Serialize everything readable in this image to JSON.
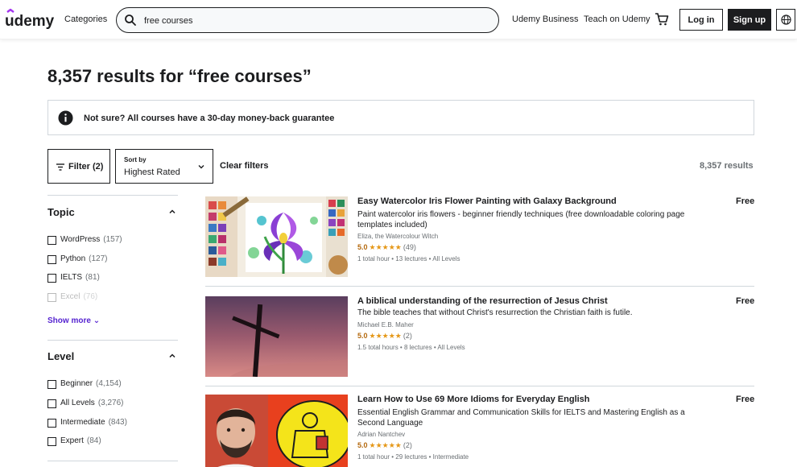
{
  "header": {
    "logo_text": "udemy",
    "categories_label": "Categories",
    "search_value": "free courses",
    "udemy_business_label": "Udemy Business",
    "teach_label": "Teach on Udemy",
    "login_label": "Log in",
    "signup_label": "Sign up"
  },
  "page_title": "8,357 results for “free courses”",
  "banner_text": "Not sure? All courses have a 30-day money-back guarantee",
  "toolbar": {
    "filter_label": "Filter (2)",
    "sort_label": "Sort by",
    "sort_value": "Highest Rated",
    "clear_filters": "Clear filters",
    "results_count": "8,357 results"
  },
  "sidebar": {
    "topic": {
      "title": "Topic",
      "items": [
        {
          "label": "WordPress",
          "count": "(157)"
        },
        {
          "label": "Python",
          "count": "(127)"
        },
        {
          "label": "IELTS",
          "count": "(81)"
        },
        {
          "label": "Excel",
          "count": "(76)"
        }
      ],
      "show_more": "Show more"
    },
    "level": {
      "title": "Level",
      "items": [
        {
          "label": "Beginner",
          "count": "(4,154)"
        },
        {
          "label": "All Levels",
          "count": "(3,276)"
        },
        {
          "label": "Intermediate",
          "count": "(843)"
        },
        {
          "label": "Expert",
          "count": "(84)"
        }
      ]
    }
  },
  "courses": [
    {
      "title": "Easy Watercolor Iris Flower Painting with Galaxy Background",
      "description": "Paint watercolor iris flowers - beginner friendly techniques (free downloadable coloring page templates included)",
      "instructor": "Eliza, the Watercolour Witch",
      "rating": "5.0",
      "stars": "★★★★★",
      "reviews": "(49)",
      "meta": "1 total hour • 13 lectures • All Levels",
      "price": "Free"
    },
    {
      "title": "A biblical understanding of the resurrection of Jesus Christ",
      "description": "The bible teaches that without Christ's resurrection the Christian faith is futile.",
      "instructor": "Michael E.B. Maher",
      "rating": "5.0",
      "stars": "★★★★★",
      "reviews": "(2)",
      "meta": "1.5 total hours • 8 lectures • All Levels",
      "price": "Free"
    },
    {
      "title": "Learn How to Use 69 More Idioms for Everyday English",
      "description": "Essential English Grammar and Communication Skills for IELTS and Mastering English as a Second Language",
      "instructor": "Adrian Nantchev",
      "rating": "5.0",
      "stars": "★★★★★",
      "reviews": "(2)",
      "meta": "1 total hour • 29 lectures • Intermediate",
      "price": "Free"
    }
  ],
  "colors": {
    "brand_purple": "#a435f0",
    "link_purple": "#5624d0",
    "rating_orange": "#b4690e",
    "star_yellow": "#e59819",
    "text_dark": "#1c1d1f"
  }
}
